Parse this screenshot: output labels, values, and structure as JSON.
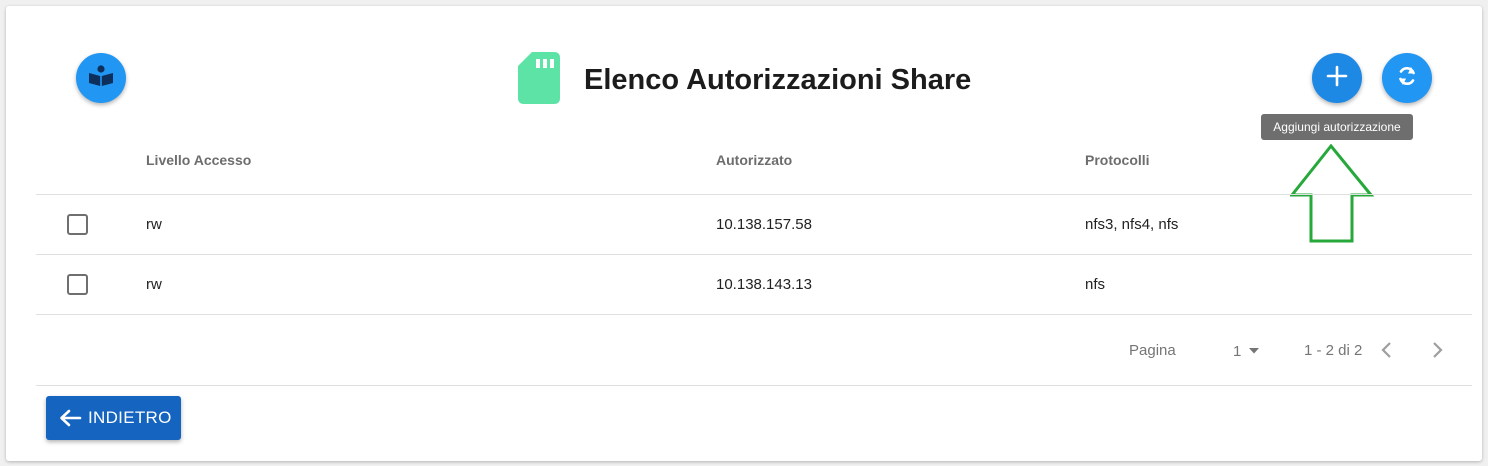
{
  "header": {
    "title": "Elenco Autorizzazioni Share",
    "help_icon": "book-reader-icon",
    "title_icon": "sd-card-icon",
    "add_icon": "plus-icon",
    "refresh_icon": "refresh-icon"
  },
  "tooltip": {
    "text": "Aggiungi autorizzazione"
  },
  "table": {
    "columns": [
      "Livello Accesso",
      "Autorizzato",
      "Protocolli"
    ],
    "rows": [
      {
        "livello": "rw",
        "autorizzato": "10.138.157.58",
        "protocolli": "nfs3, nfs4, nfs"
      },
      {
        "livello": "rw",
        "autorizzato": "10.138.143.13",
        "protocolli": "nfs"
      }
    ]
  },
  "pagination": {
    "label": "Pagina",
    "current_page": "1",
    "range": "1 - 2 di 2"
  },
  "footer": {
    "back_label": "INDIETRO",
    "back_icon": "arrow-left-icon"
  },
  "annotation": {
    "arrow_icon": "arrow-up-outline-icon"
  },
  "colors": {
    "primary": "#2196f3",
    "back_button": "#1565c0",
    "title_icon": "#5de3a5",
    "arrow": "#27a83a"
  }
}
